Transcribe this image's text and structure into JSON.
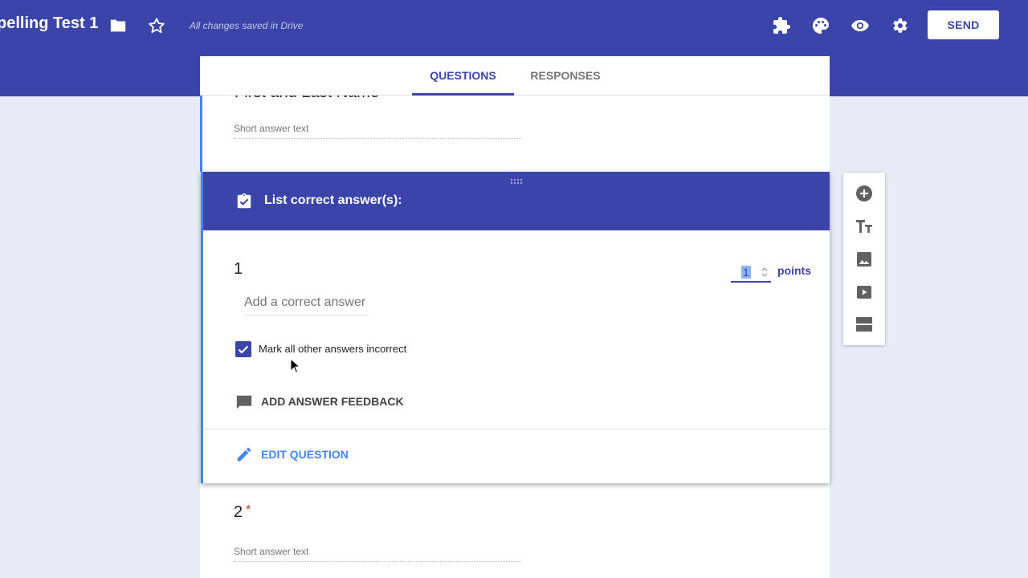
{
  "header": {
    "title": "pelling Test 1",
    "saved_status": "All changes saved in Drive",
    "send_label": "SEND",
    "icons": [
      "folder-icon",
      "star-icon",
      "puzzle-icon",
      "palette-icon",
      "eye-icon",
      "gear-icon"
    ]
  },
  "tabs": [
    {
      "label": "QUESTIONS",
      "active": true
    },
    {
      "label": "RESPONSES",
      "active": false
    }
  ],
  "previous_question": {
    "title": "First and Last Name",
    "placeholder": "Short answer text"
  },
  "answer_key": {
    "header_title": "List correct answer(s):",
    "question_number": "1",
    "points_value": "1",
    "points_label": "points",
    "add_answer_placeholder": "Add a correct answer",
    "mark_incorrect_label": "Mark all other answers incorrect",
    "mark_incorrect_checked": true,
    "feedback_label": "ADD ANSWER FEEDBACK",
    "edit_label": "EDIT QUESTION"
  },
  "next_question": {
    "number": "2",
    "required_mark": "*",
    "placeholder": "Short answer text"
  },
  "toolbar": {
    "icons": [
      "add-question-icon",
      "title-text-icon",
      "image-icon",
      "video-icon",
      "section-icon"
    ]
  },
  "colors": {
    "primary": "#3b45a9",
    "accent_blue": "#4285f4",
    "background": "#e8eaf6",
    "required": "#d93025"
  }
}
